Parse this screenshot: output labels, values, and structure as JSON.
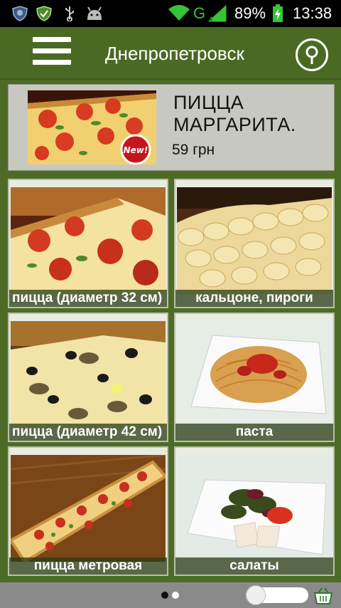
{
  "status_bar": {
    "network": "G",
    "battery_percent": "89%",
    "time": "13:38"
  },
  "header": {
    "city": "Днепропетровск"
  },
  "promo": {
    "title": "ПИЦЦА МАРГАРИТА.",
    "price": "59 грн",
    "badge": "New!"
  },
  "categories": [
    {
      "label": "пицца (диаметр 32 см)"
    },
    {
      "label": "кальцоне, пироги"
    },
    {
      "label": "пицца (диаметр 42 см)"
    },
    {
      "label": "паста"
    },
    {
      "label": "пицца метровая"
    },
    {
      "label": "салаты"
    }
  ],
  "pager": {
    "page": 1,
    "pages": 2
  },
  "colors": {
    "header": "#4a6a24",
    "background": "#4d6b27",
    "label_bg": "#283c14"
  }
}
